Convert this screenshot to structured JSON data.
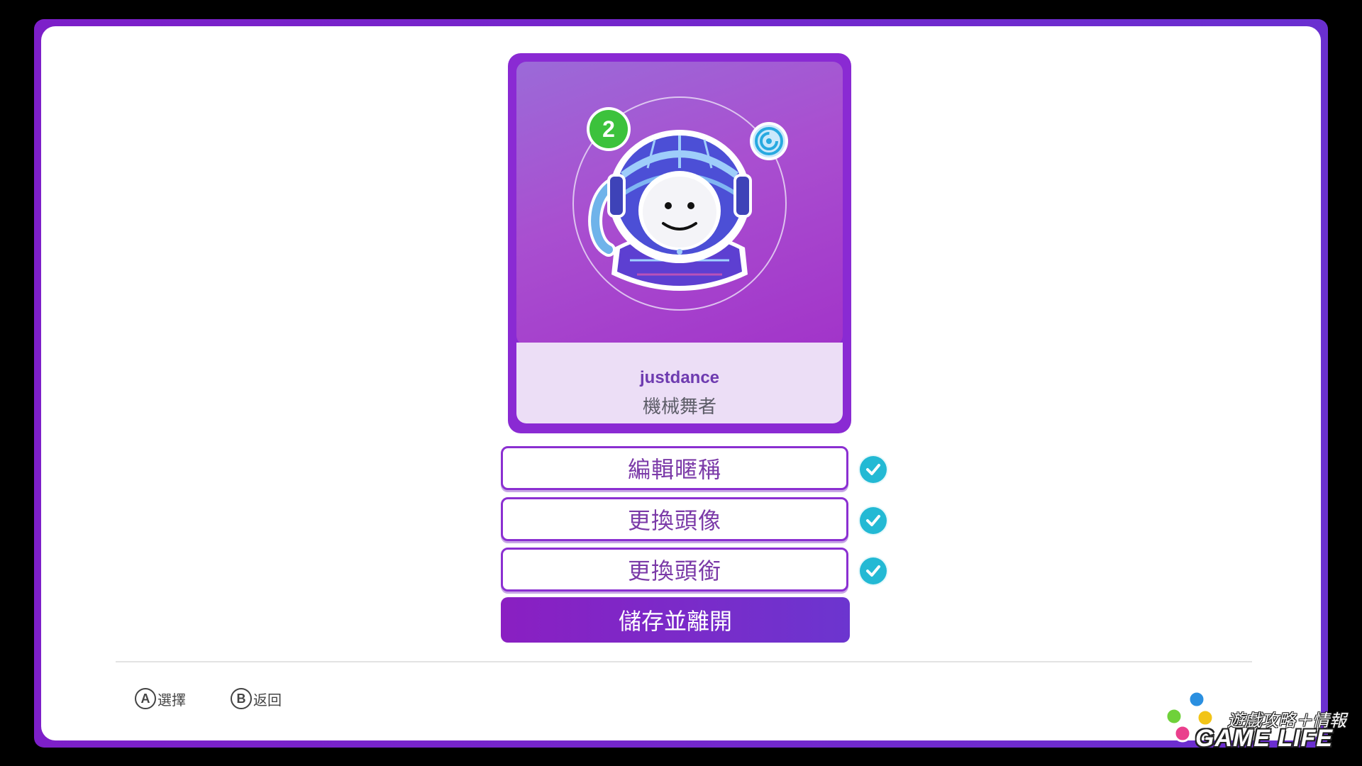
{
  "profile": {
    "level_badge": "2",
    "nickname": "justdance",
    "title": "機械舞者"
  },
  "options": [
    {
      "label": "編輯暱稱",
      "checked": true
    },
    {
      "label": "更換頭像",
      "checked": true
    },
    {
      "label": "更換頭銜",
      "checked": true
    }
  ],
  "save_button": {
    "label": "儲存並離開"
  },
  "controls": [
    {
      "key": "A",
      "label": "選擇"
    },
    {
      "key": "B",
      "label": "返回"
    }
  ],
  "watermark": {
    "top_text": "遊戲攻略＋情報",
    "bottom_text": "GAME LIFE"
  },
  "colors": {
    "frame": "#7d1fc9",
    "card": "#8a2ad3",
    "check": "#23b9d4",
    "save": "#8a1fc2",
    "level_badge": "#3cc23c"
  },
  "icons": {
    "avatar": "disco-robot-avatar",
    "ubisoft": "ubisoft-swirl-icon",
    "check": "check-icon"
  }
}
